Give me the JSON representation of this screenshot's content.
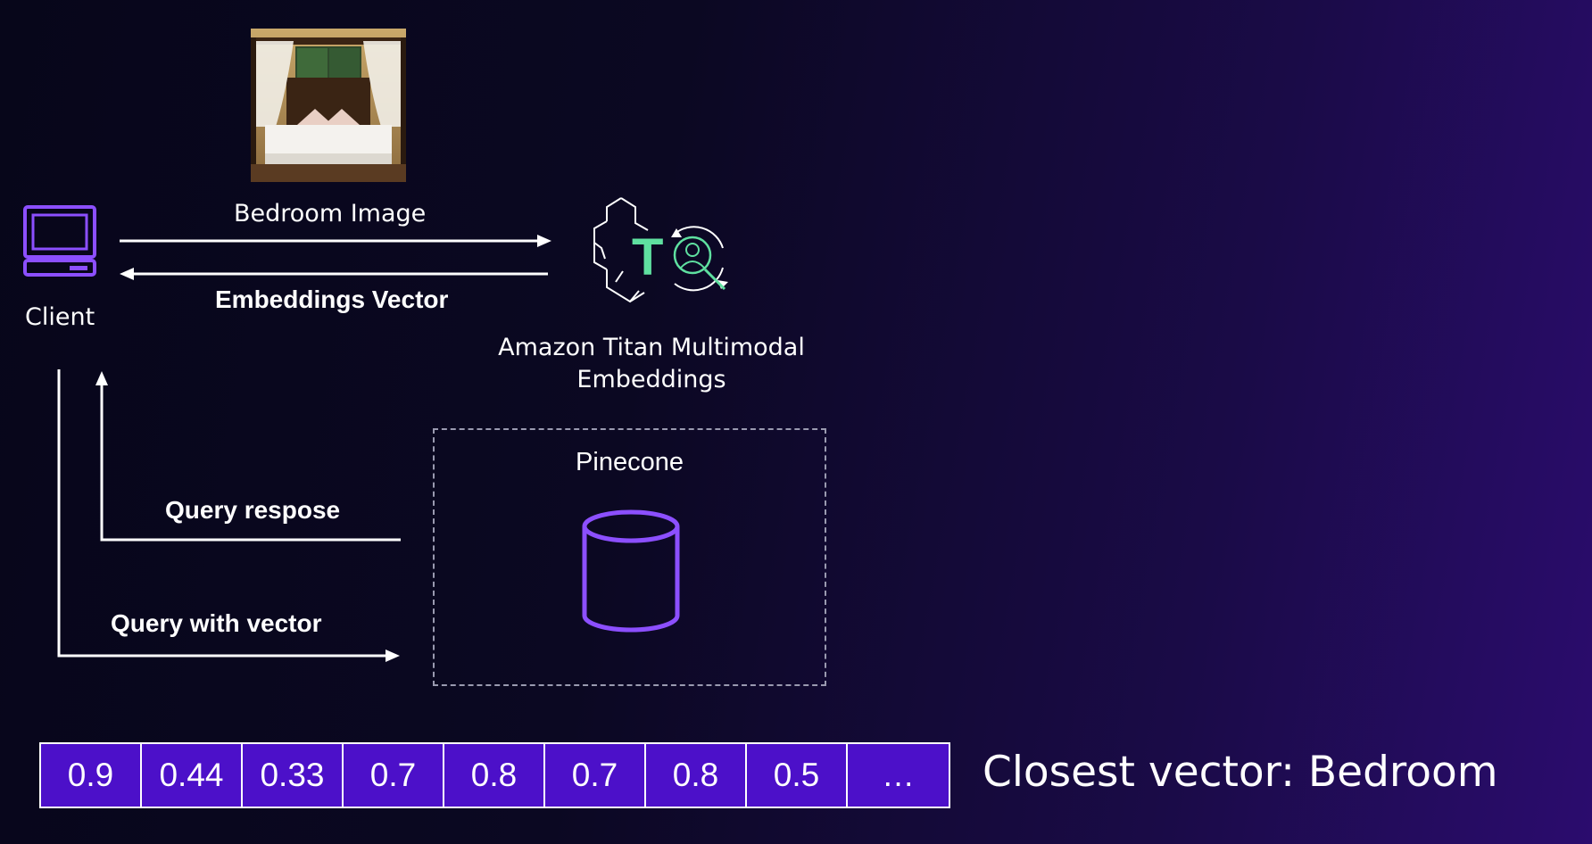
{
  "labels": {
    "bedroom_image": "Bedroom Image",
    "embeddings_vector": "Embeddings Vector",
    "client": "Client",
    "titan_line1": "Amazon Titan Multimodal",
    "titan_line2": "Embeddings",
    "pinecone": "Pinecone",
    "query_response": "Query respose",
    "query_with_vector": "Query with vector",
    "closest_vector": "Closest vector: Bedroom",
    "titan_icon_letter": "T"
  },
  "vector_values": [
    "0.9",
    "0.44",
    "0.33",
    "0.7",
    "0.8",
    "0.7",
    "0.8",
    "0.5",
    "…"
  ],
  "colors": {
    "accent_purple": "#8c4fff",
    "cell_fill": "#4c10c9",
    "titan_green": "#5fe0a0",
    "arrow_white": "#ffffff",
    "dashed_border": "#9a9ab0"
  },
  "icons": {
    "client": "laptop-icon",
    "model": "titan-multimodal-icon",
    "database": "database-cylinder-icon",
    "image": "bedroom-photo"
  }
}
